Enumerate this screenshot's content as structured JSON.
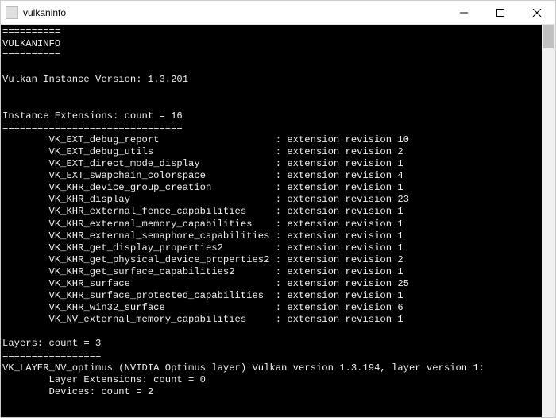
{
  "window": {
    "title": "vulkaninfo"
  },
  "terminal": {
    "header_rule": "==========",
    "header_name": "VULKANINFO",
    "instance_version_label": "Vulkan Instance Version:",
    "instance_version_value": "1.3.201",
    "instance_ext_label": "Instance Extensions:",
    "instance_ext_count_label": "count =",
    "instance_ext_count_value": "16",
    "instance_ext_rule": "===============================",
    "ext_revision_label": "extension revision",
    "extensions": [
      {
        "name": "VK_EXT_debug_report",
        "revision": "10"
      },
      {
        "name": "VK_EXT_debug_utils",
        "revision": "2"
      },
      {
        "name": "VK_EXT_direct_mode_display",
        "revision": "1"
      },
      {
        "name": "VK_EXT_swapchain_colorspace",
        "revision": "4"
      },
      {
        "name": "VK_KHR_device_group_creation",
        "revision": "1"
      },
      {
        "name": "VK_KHR_display",
        "revision": "23"
      },
      {
        "name": "VK_KHR_external_fence_capabilities",
        "revision": "1"
      },
      {
        "name": "VK_KHR_external_memory_capabilities",
        "revision": "1"
      },
      {
        "name": "VK_KHR_external_semaphore_capabilities",
        "revision": "1"
      },
      {
        "name": "VK_KHR_get_display_properties2",
        "revision": "1"
      },
      {
        "name": "VK_KHR_get_physical_device_properties2",
        "revision": "2"
      },
      {
        "name": "VK_KHR_get_surface_capabilities2",
        "revision": "1"
      },
      {
        "name": "VK_KHR_surface",
        "revision": "25"
      },
      {
        "name": "VK_KHR_surface_protected_capabilities",
        "revision": "1"
      },
      {
        "name": "VK_KHR_win32_surface",
        "revision": "6"
      },
      {
        "name": "VK_NV_external_memory_capabilities",
        "revision": "1"
      }
    ],
    "layers_label": "Layers:",
    "layers_count_label": "count =",
    "layers_count_value": "3",
    "layers_rule": "=================",
    "layer0_line": "VK_LAYER_NV_optimus (NVIDIA Optimus layer) Vulkan version 1.3.194, layer version 1:",
    "layer0_ext_line": "Layer Extensions: count = 0",
    "layer0_dev_line": "Devices: count = 2"
  }
}
